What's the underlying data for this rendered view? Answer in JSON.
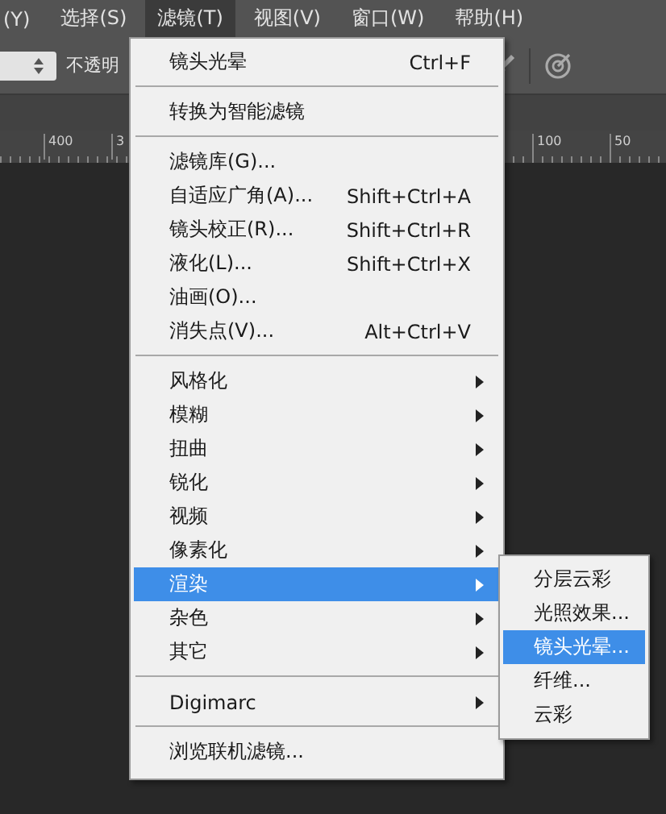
{
  "menu_bar": [
    {
      "label": "(Y)",
      "selected": false
    },
    {
      "label": "选择(S)",
      "selected": false
    },
    {
      "label": "滤镜(T)",
      "selected": true
    },
    {
      "label": "视图(V)",
      "selected": false
    },
    {
      "label": "窗口(W)",
      "selected": false
    },
    {
      "label": "帮助(H)",
      "selected": false
    }
  ],
  "options_bar": {
    "opacity_label": "不透明"
  },
  "ruler": {
    "labels": [
      "400",
      "3",
      "100",
      "50"
    ]
  },
  "filter_menu": [
    {
      "kind": "item",
      "label": "镜头光晕",
      "shortcut": "Ctrl+F",
      "submenu": false,
      "selected": false
    },
    {
      "kind": "separator"
    },
    {
      "kind": "item",
      "label": "转换为智能滤镜",
      "submenu": false,
      "selected": false
    },
    {
      "kind": "separator"
    },
    {
      "kind": "item",
      "label": "滤镜库(G)...",
      "submenu": false,
      "selected": false
    },
    {
      "kind": "item",
      "label": "自适应广角(A)...",
      "shortcut": "Shift+Ctrl+A",
      "submenu": false,
      "selected": false
    },
    {
      "kind": "item",
      "label": "镜头校正(R)...",
      "shortcut": "Shift+Ctrl+R",
      "submenu": false,
      "selected": false
    },
    {
      "kind": "item",
      "label": "液化(L)...",
      "shortcut": "Shift+Ctrl+X",
      "submenu": false,
      "selected": false
    },
    {
      "kind": "item",
      "label": "油画(O)...",
      "submenu": false,
      "selected": false
    },
    {
      "kind": "item",
      "label": "消失点(V)...",
      "shortcut": "Alt+Ctrl+V",
      "submenu": false,
      "selected": false
    },
    {
      "kind": "separator"
    },
    {
      "kind": "item",
      "label": "风格化",
      "submenu": true,
      "selected": false
    },
    {
      "kind": "item",
      "label": "模糊",
      "submenu": true,
      "selected": false
    },
    {
      "kind": "item",
      "label": "扭曲",
      "submenu": true,
      "selected": false
    },
    {
      "kind": "item",
      "label": "锐化",
      "submenu": true,
      "selected": false
    },
    {
      "kind": "item",
      "label": "视频",
      "submenu": true,
      "selected": false
    },
    {
      "kind": "item",
      "label": "像素化",
      "submenu": true,
      "selected": false
    },
    {
      "kind": "item",
      "label": "渲染",
      "submenu": true,
      "selected": true
    },
    {
      "kind": "item",
      "label": "杂色",
      "submenu": true,
      "selected": false
    },
    {
      "kind": "item",
      "label": "其它",
      "submenu": true,
      "selected": false
    },
    {
      "kind": "separator"
    },
    {
      "kind": "item",
      "label": "Digimarc",
      "submenu": true,
      "selected": false
    },
    {
      "kind": "separator"
    },
    {
      "kind": "item",
      "label": "浏览联机滤镜...",
      "submenu": false,
      "selected": false
    }
  ],
  "render_submenu": [
    {
      "label": "分层云彩",
      "selected": false
    },
    {
      "label": "光照效果...",
      "selected": false
    },
    {
      "label": "镜头光晕...",
      "selected": true
    },
    {
      "label": "纤维...",
      "selected": false
    },
    {
      "label": "云彩",
      "selected": false
    }
  ]
}
